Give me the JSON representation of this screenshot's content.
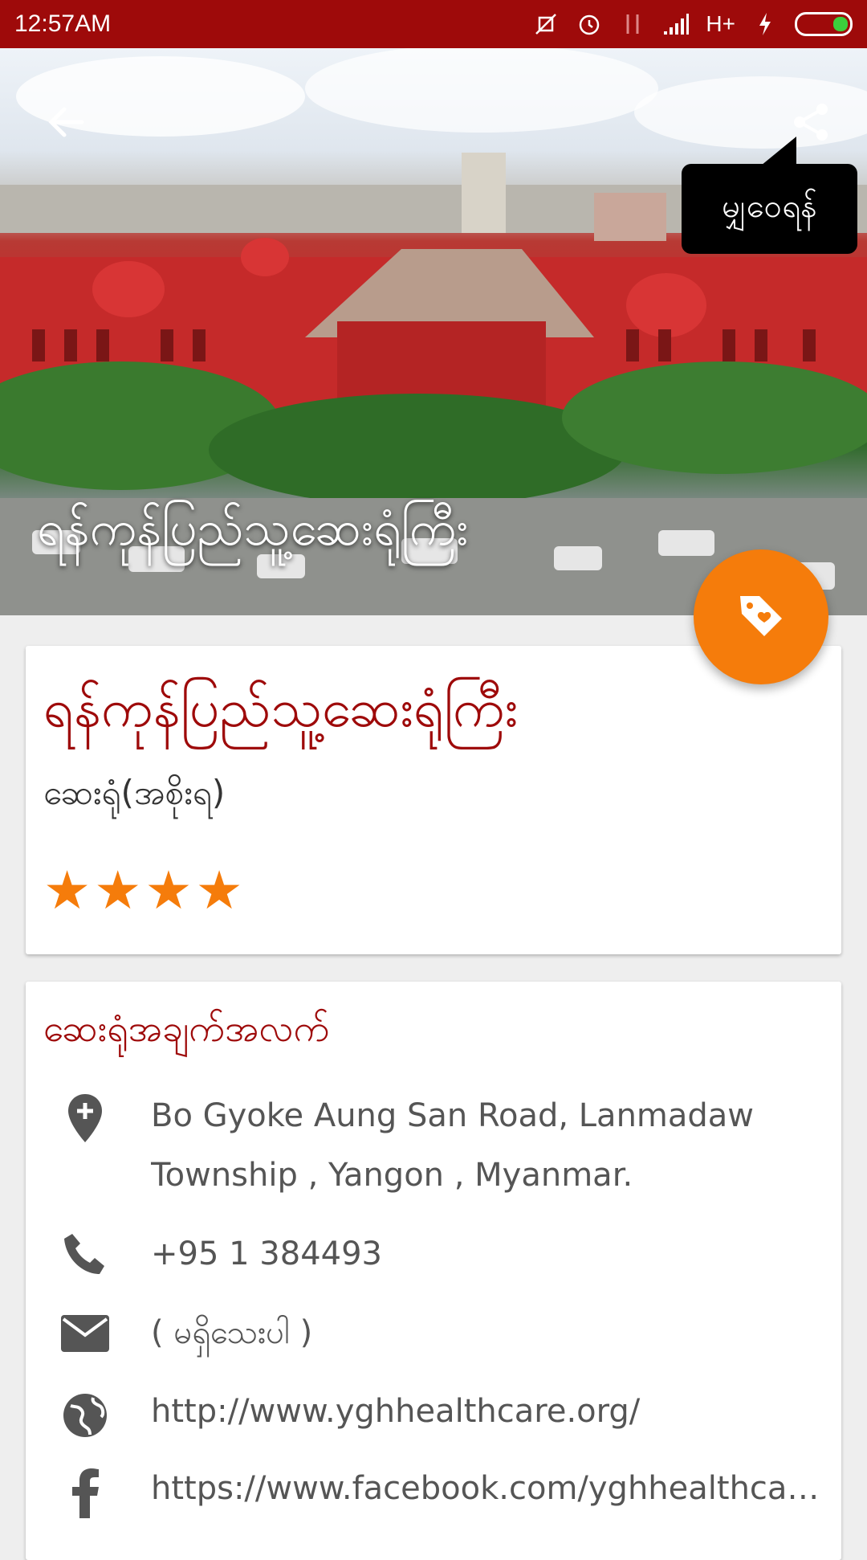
{
  "status_bar": {
    "time": "12:57AM",
    "network": "H+",
    "icons": [
      "mute-vibrate-icon",
      "alarm-icon",
      "data-arrows-icon",
      "signal-icon",
      "charging-icon",
      "battery-icon"
    ]
  },
  "hero": {
    "title": "ရန်ကုန်ပြည်သူ့ဆေးရုံကြီး",
    "share_tooltip": "မျှဝေရန်"
  },
  "summary": {
    "name": "ရန်ကုန်ပြည်သူ့ဆေးရုံကြီး",
    "category": "ဆေးရုံ(အစိုးရ)",
    "rating": 4,
    "stars": "★★★★"
  },
  "details": {
    "section_title": "ဆေးရုံအချက်အလက်",
    "address": "Bo Gyoke Aung San Road, Lanmadaw Township , Yangon , Myanmar.",
    "phone": "+95 1 384493",
    "email": "( မရှိသေးပါ )",
    "website": "http://www.yghhealthcare.org/",
    "facebook": "https://www.facebook.com/yghhealthcare/"
  },
  "colors": {
    "brand": "#9e0a0a",
    "fab": "#f57c0b",
    "star": "#f57c0b"
  }
}
